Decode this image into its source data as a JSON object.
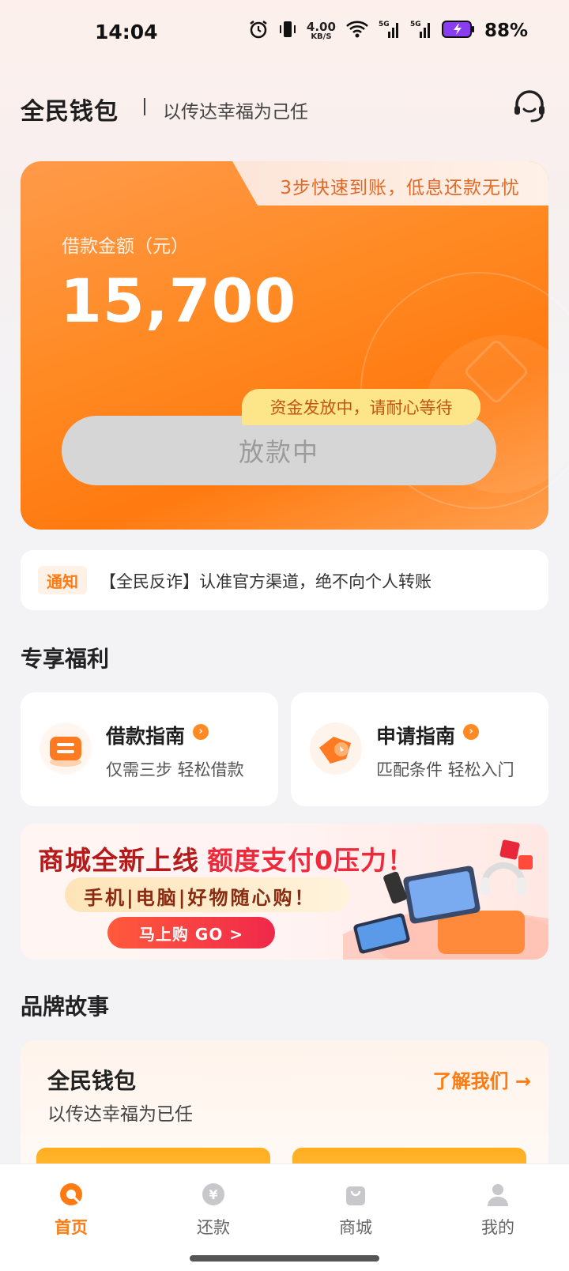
{
  "status_bar": {
    "time": "14:04",
    "net_speed_value": "4.00",
    "net_speed_unit": "KB/S",
    "signal1": "5G",
    "signal2": "5G",
    "battery": "88%",
    "icons": [
      "alarm-icon",
      "vibrate-icon",
      "wifi-icon",
      "signal-icon",
      "battery-charging-icon"
    ]
  },
  "header": {
    "brand": "全民钱包",
    "slogan": "以传达幸福为己任",
    "service_icon": "customer-service-icon"
  },
  "loan_card": {
    "promo": "3步快速到账，低息还款无忧",
    "amount_label": "借款金额（元）",
    "amount_value": "15,700",
    "status_bubble": "资金发放中，请耐心等待",
    "button_label": "放款中"
  },
  "notice": {
    "tag": "通知",
    "text": "【全民反诈】认准官方渠道，绝不向个人转账"
  },
  "benefits": {
    "title": "专享福利",
    "cards": [
      {
        "title": "借款指南",
        "subtitle": "仅需三步 轻松借款",
        "icon": "loan-guide-icon"
      },
      {
        "title": "申请指南",
        "subtitle": "匹配条件 轻松入门",
        "icon": "apply-guide-icon"
      }
    ]
  },
  "banner": {
    "title_part1": "商城全新上线",
    "title_part2": "额度支付0压力！",
    "subtitle": "手机|电脑|好物随心购！",
    "button": "马上购  GO >"
  },
  "brand_story": {
    "title": "品牌故事",
    "name": "全民钱包",
    "slogan": "以传达幸福为已任",
    "link": "了解我们 →"
  },
  "bottom_nav": {
    "items": [
      {
        "label": "首页",
        "icon": "home-icon",
        "active": true
      },
      {
        "label": "还款",
        "icon": "repay-icon",
        "active": false
      },
      {
        "label": "商城",
        "icon": "shop-icon",
        "active": false
      },
      {
        "label": "我的",
        "icon": "profile-icon",
        "active": false
      }
    ]
  },
  "colors": {
    "accent": "#ff7a10",
    "card_orange": "#ff8a24",
    "disabled_button": "#d6d6d6",
    "bubble": "#fde58a"
  }
}
